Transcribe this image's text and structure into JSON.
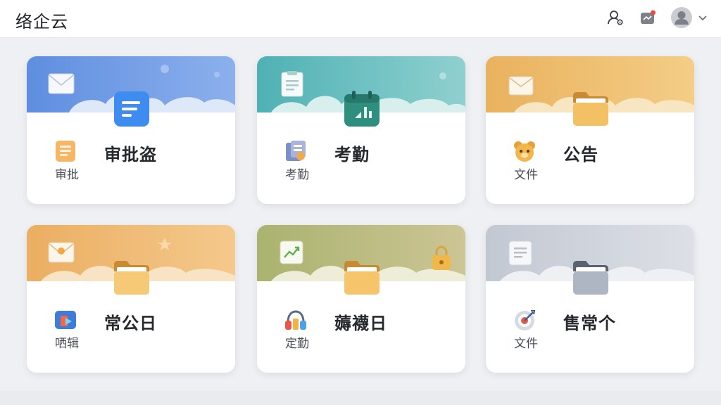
{
  "app": {
    "title": "络企云"
  },
  "toolbar": {
    "user_icon": "user-settings-icon",
    "message_icon": "message-notification-icon",
    "avatar_icon": "user-avatar-icon",
    "dropdown_icon": "chevron-down-icon"
  },
  "colors": {
    "blue": "#6b97e4",
    "teal": "#63bcc0",
    "orange": "#eebe70",
    "peach": "#eebc7d",
    "olive": "#b6bf82",
    "gray": "#ccd1d9"
  },
  "cards": [
    {
      "title": "审批盗",
      "label": "审批",
      "theme": "blue",
      "banner_icon": "envelope-icon",
      "center_icon": "document-icon",
      "small_icon": "document-icon"
    },
    {
      "title": "考勤",
      "label": "考勤",
      "theme": "teal",
      "banner_icon": "clipboard-icon",
      "center_icon": "calendar-icon",
      "small_icon": "attendance-icon"
    },
    {
      "title": "公告",
      "label": "文件",
      "theme": "orange",
      "banner_icon": "envelope-icon",
      "center_icon": "folder-icon",
      "small_icon": "bear-icon"
    },
    {
      "title": "常公日",
      "label": "哂辑",
      "theme": "peach",
      "banner_icon": "envelope-icon",
      "center_icon": "folder-icon",
      "small_icon": "app-icon"
    },
    {
      "title": "薅襪日",
      "label": "定勤",
      "theme": "olive",
      "banner_icon": "chart-icon",
      "center_icon": "folder-icon",
      "small_icon": "headphones-icon"
    },
    {
      "title": "售常个",
      "label": "文件",
      "theme": "gray",
      "banner_icon": "document-icon",
      "center_icon": "folder-icon",
      "small_icon": "target-icon"
    }
  ]
}
